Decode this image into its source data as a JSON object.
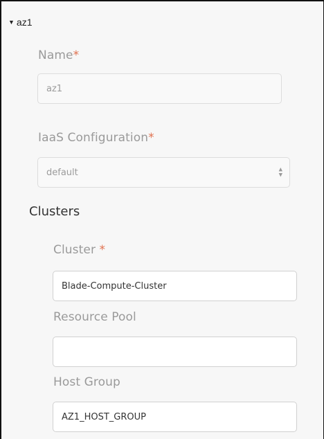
{
  "availability_zone": {
    "title": "az1",
    "caret_icon": "caret-down-icon",
    "name": {
      "label": "Name",
      "required_mark": "*",
      "value": "az1"
    },
    "iaas_configuration": {
      "label": "IaaS Configuration",
      "required_mark": "*",
      "selected_value": "default",
      "arrows_icon": "select-arrows-icon"
    }
  },
  "clusters": {
    "title": "Clusters",
    "cluster": {
      "label": "Cluster ",
      "required_mark": "*",
      "value": "Blade-Compute-Cluster"
    },
    "resource_pool": {
      "label": "Resource Pool",
      "value": ""
    },
    "host_group": {
      "label": "Host Group",
      "value": "AZ1_HOST_GROUP"
    }
  },
  "colors": {
    "required": "#e0714f",
    "label": "#9a9a9a",
    "panel_background": "#f7f7f7"
  }
}
